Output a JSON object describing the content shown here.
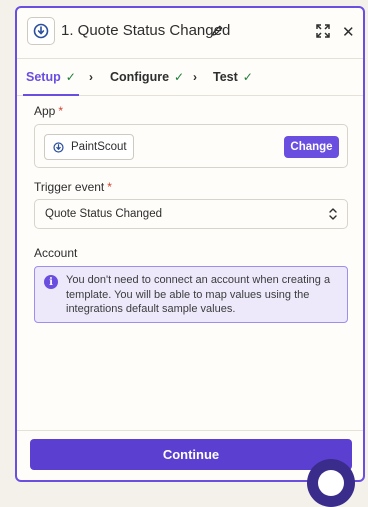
{
  "step": {
    "title": "1. Quote Status Changed"
  },
  "tabs": [
    {
      "label": "Setup",
      "done": true,
      "active": true
    },
    {
      "label": "Configure",
      "done": true,
      "active": false
    },
    {
      "label": "Test",
      "done": true,
      "active": false
    }
  ],
  "app_section": {
    "label": "App",
    "required_mark": "*",
    "app_name": "PaintScout",
    "change_label": "Change"
  },
  "trigger_section": {
    "label": "Trigger event",
    "required_mark": "*",
    "selected_value": "Quote Status Changed"
  },
  "account_section": {
    "label": "Account",
    "info_icon_glyph": "i",
    "info_text": "You don't need to connect an account when creating a template. You will be able to map values using the integrations default sample values."
  },
  "footer": {
    "continue_label": "Continue"
  },
  "icons": {
    "check_glyph": "✓",
    "chevron_glyph": "›",
    "close_glyph": "✕"
  },
  "colors": {
    "accent": "#6a4ee0",
    "button": "#5b3fd1",
    "check": "#1a7f37",
    "required": "#d5422f",
    "info_bg": "#ede9fb"
  }
}
